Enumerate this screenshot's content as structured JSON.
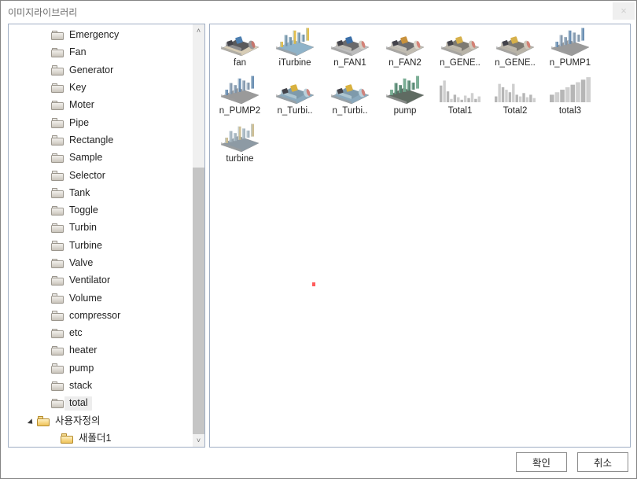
{
  "window": {
    "title": "이미지라이브러리",
    "close_label": "×"
  },
  "tree": {
    "items": [
      {
        "label": "Emergency",
        "indent": 1,
        "icon": "folder-icon",
        "expander": "none",
        "selected": false
      },
      {
        "label": "Fan",
        "indent": 1,
        "icon": "folder-icon",
        "expander": "none",
        "selected": false
      },
      {
        "label": "Generator",
        "indent": 1,
        "icon": "folder-icon",
        "expander": "none",
        "selected": false
      },
      {
        "label": "Key",
        "indent": 1,
        "icon": "folder-icon",
        "expander": "none",
        "selected": false
      },
      {
        "label": "Moter",
        "indent": 1,
        "icon": "folder-icon",
        "expander": "none",
        "selected": false
      },
      {
        "label": "Pipe",
        "indent": 1,
        "icon": "folder-icon",
        "expander": "none",
        "selected": false
      },
      {
        "label": "Rectangle",
        "indent": 1,
        "icon": "folder-icon",
        "expander": "none",
        "selected": false
      },
      {
        "label": "Sample",
        "indent": 1,
        "icon": "folder-icon",
        "expander": "none",
        "selected": false
      },
      {
        "label": "Selector",
        "indent": 1,
        "icon": "folder-icon",
        "expander": "none",
        "selected": false
      },
      {
        "label": "Tank",
        "indent": 1,
        "icon": "folder-icon",
        "expander": "none",
        "selected": false
      },
      {
        "label": "Toggle",
        "indent": 1,
        "icon": "folder-icon",
        "expander": "none",
        "selected": false
      },
      {
        "label": "Turbin",
        "indent": 1,
        "icon": "folder-icon",
        "expander": "none",
        "selected": false
      },
      {
        "label": "Turbine",
        "indent": 1,
        "icon": "folder-icon",
        "expander": "none",
        "selected": false
      },
      {
        "label": "Valve",
        "indent": 1,
        "icon": "folder-icon",
        "expander": "none",
        "selected": false
      },
      {
        "label": "Ventilator",
        "indent": 1,
        "icon": "folder-icon",
        "expander": "none",
        "selected": false
      },
      {
        "label": "Volume",
        "indent": 1,
        "icon": "folder-icon",
        "expander": "none",
        "selected": false
      },
      {
        "label": "compressor",
        "indent": 1,
        "icon": "folder-icon",
        "expander": "none",
        "selected": false
      },
      {
        "label": "etc",
        "indent": 1,
        "icon": "folder-icon",
        "expander": "none",
        "selected": false
      },
      {
        "label": "heater",
        "indent": 1,
        "icon": "folder-icon",
        "expander": "none",
        "selected": false
      },
      {
        "label": "pump",
        "indent": 1,
        "icon": "folder-icon",
        "expander": "none",
        "selected": false
      },
      {
        "label": "stack",
        "indent": 1,
        "icon": "folder-icon",
        "expander": "none",
        "selected": false
      },
      {
        "label": "total",
        "indent": 1,
        "icon": "folder-icon",
        "expander": "none",
        "selected": true
      },
      {
        "label": "사용자정의",
        "indent": 2,
        "icon": "folder-gold-icon",
        "expander": "expanded",
        "selected": false
      },
      {
        "label": "새폴더1",
        "indent": 3,
        "icon": "folder-gold-icon",
        "expander": "none",
        "selected": false
      }
    ],
    "scrollbar": {
      "up_arrow": "˄",
      "down_arrow": "˅"
    }
  },
  "content": {
    "thumbnails": [
      {
        "label": "fan",
        "kind": "machine",
        "variant": "fan"
      },
      {
        "label": "iTurbine",
        "kind": "machine",
        "variant": "iturbine"
      },
      {
        "label": "n_FAN1",
        "kind": "machine",
        "variant": "nfan1"
      },
      {
        "label": "n_FAN2",
        "kind": "machine",
        "variant": "nfan2"
      },
      {
        "label": "n_GENE..",
        "kind": "machine",
        "variant": "ngen1"
      },
      {
        "label": "n_GENE..",
        "kind": "machine",
        "variant": "ngen2"
      },
      {
        "label": "n_PUMP1",
        "kind": "machine",
        "variant": "npump1"
      },
      {
        "label": "n_PUMP2",
        "kind": "machine",
        "variant": "npump2"
      },
      {
        "label": "n_Turbi..",
        "kind": "machine",
        "variant": "nturb1"
      },
      {
        "label": "n_Turbi..",
        "kind": "machine",
        "variant": "nturb2"
      },
      {
        "label": "pump",
        "kind": "machine",
        "variant": "pump"
      },
      {
        "label": "Total1",
        "kind": "barchart",
        "variant": "total1"
      },
      {
        "label": "Total2",
        "kind": "barchart",
        "variant": "total2"
      },
      {
        "label": "total3",
        "kind": "barchart",
        "variant": "total3"
      },
      {
        "label": "turbine",
        "kind": "machine",
        "variant": "turbine"
      }
    ]
  },
  "footer": {
    "ok_label": "확인",
    "cancel_label": "취소"
  },
  "colors": {
    "panel_border": "#a0aec4",
    "window_border": "#848484",
    "title_text": "#6b6b6b",
    "selection_bg": "#ededed",
    "scrollbar_track": "#c5c5c5",
    "scrollbar_thumb": "#f0f0f0",
    "folder_gold": "#eec35b",
    "red_dot": "#ff5b5b"
  }
}
